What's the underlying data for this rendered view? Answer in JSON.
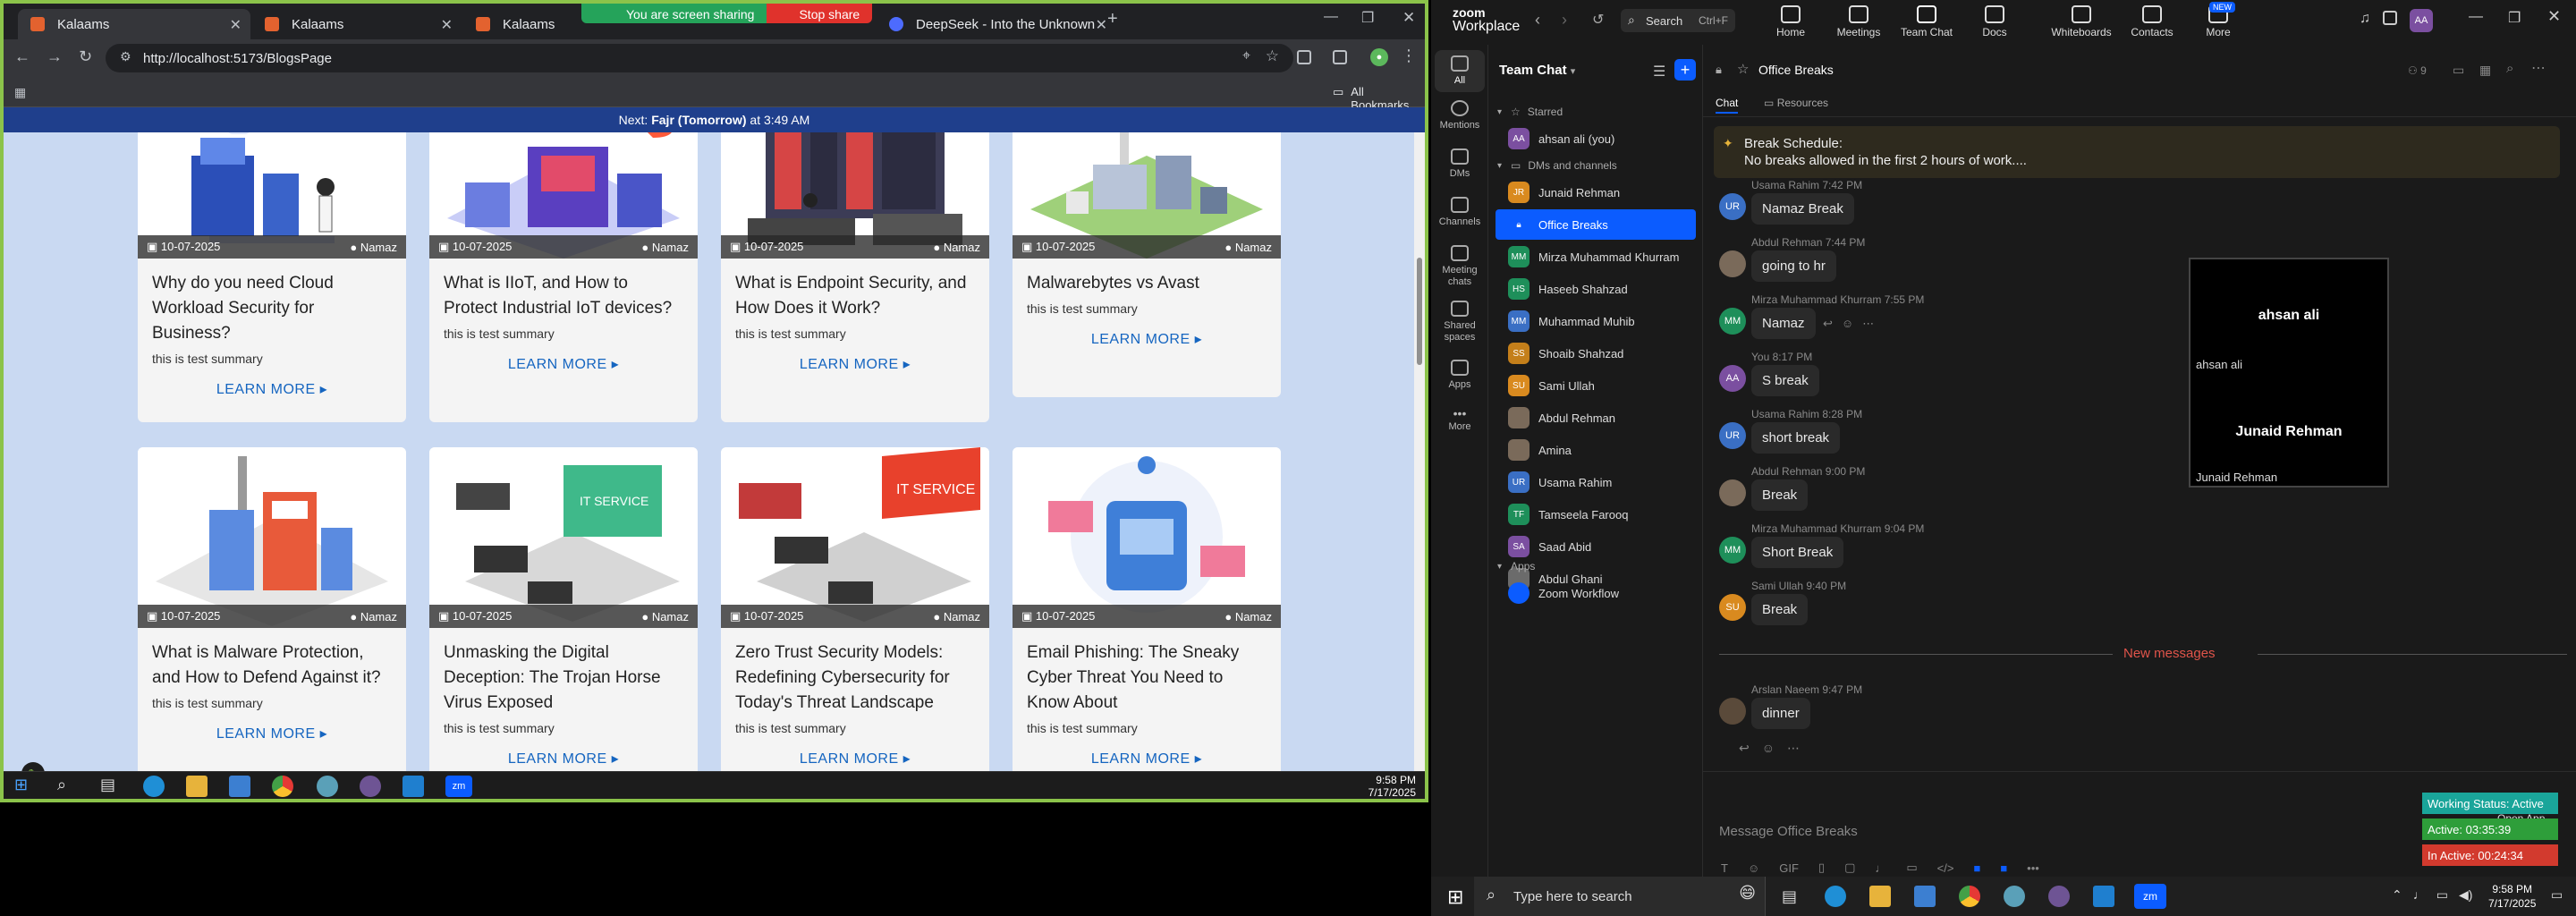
{
  "browser": {
    "tabs": [
      {
        "title": "Kalaams",
        "active": true
      },
      {
        "title": "Kalaams",
        "active": false
      },
      {
        "title": "Kalaams",
        "active": false
      },
      {
        "title": "DeepSeek - Into the Unknown",
        "active": false
      }
    ],
    "share_status": "You are screen sharing",
    "stop_share": "Stop share",
    "url": "http://localhost:5173/BlogsPage",
    "bookmarks_label": "All Bookmarks"
  },
  "page": {
    "prayer_prefix": "Next:",
    "prayer_name": "Fajr (Tomorrow)",
    "prayer_time": "at 3:49 AM",
    "learn_more": "LEARN MORE",
    "cards": [
      {
        "date": "10-07-2025",
        "author": "Namaz",
        "title": "Why do you need Cloud Workload Security for Business?",
        "summary": "this is test summary"
      },
      {
        "date": "10-07-2025",
        "author": "Namaz",
        "title": "What is IIoT, and How to Protect Industrial IoT devices?",
        "summary": "this is test summary"
      },
      {
        "date": "10-07-2025",
        "author": "Namaz",
        "title": "What is Endpoint Security, and How Does it Work?",
        "summary": "this is test summary"
      },
      {
        "date": "10-07-2025",
        "author": "Namaz",
        "title": "Malwarebytes vs Avast",
        "summary": "this is test summary"
      },
      {
        "date": "10-07-2025",
        "author": "Namaz",
        "title": "What is Malware Protection, and How to Defend Against it?",
        "summary": "this is test summary"
      },
      {
        "date": "10-07-2025",
        "author": "Namaz",
        "title": "Unmasking the Digital Deception: The Trojan Horse Virus Exposed",
        "summary": "this is test summary"
      },
      {
        "date": "10-07-2025",
        "author": "Namaz",
        "title": "Zero Trust Security Models: Redefining Cybersecurity for Today's Threat Landscape",
        "summary": "this is test summary"
      },
      {
        "date": "10-07-2025",
        "author": "Namaz",
        "title": "Email Phishing: The Sneaky Cyber Threat You Need to Know About",
        "summary": "this is test summary"
      }
    ],
    "image_badge": "IT SERVICE"
  },
  "left_taskbar": {
    "time": "9:58 PM",
    "date": "7/17/2025"
  },
  "zoom": {
    "brand_top": "zoom",
    "brand_bottom": "Workplace",
    "search_label": "Search",
    "search_shortcut": "Ctrl+F",
    "nav": [
      "Home",
      "Meetings",
      "Team Chat",
      "Docs",
      "Whiteboards",
      "Contacts",
      "More"
    ],
    "new_badge": "NEW",
    "user_initials": "AA",
    "rail": [
      "All",
      "Mentions",
      "DMs",
      "Channels",
      "Meeting chats",
      "Shared spaces",
      "Apps",
      "More"
    ],
    "list_title": "Team Chat",
    "sections": {
      "starred": "Starred",
      "dms": "DMs and channels",
      "apps": "Apps"
    },
    "starred": [
      {
        "name": "ahsan ali (you)",
        "initials": "AA",
        "color": "#7b4fa0"
      }
    ],
    "contacts": [
      {
        "name": "Junaid Rehman",
        "initials": "JR",
        "color": "#d98a1f"
      },
      {
        "name": "Office Breaks",
        "initials": "",
        "color": "#0b5cff"
      },
      {
        "name": "Mirza Muhammad Khurram",
        "initials": "MM",
        "color": "#1e8f5a"
      },
      {
        "name": "Haseeb Shahzad",
        "initials": "HS",
        "color": "#1e8f5a"
      },
      {
        "name": "Muhammad Muhib",
        "initials": "MM",
        "color": "#3a6fc4"
      },
      {
        "name": "Shoaib Shahzad",
        "initials": "SS",
        "color": "#c47f1a"
      },
      {
        "name": "Sami Ullah",
        "initials": "SU",
        "color": "#d98a1f"
      },
      {
        "name": "Abdul Rehman",
        "initials": "",
        "color": "#7a6a5a"
      },
      {
        "name": "Amina",
        "initials": "",
        "color": "#7a6a5a"
      },
      {
        "name": "Usama Rahim",
        "initials": "UR",
        "color": "#3a6fc4"
      },
      {
        "name": "Tamseela Farooq",
        "initials": "TF",
        "color": "#1e8f5a"
      },
      {
        "name": "Saad Abid",
        "initials": "SA",
        "color": "#7b4fa0"
      },
      {
        "name": "Abdul Ghani",
        "initials": "",
        "color": "#6b6b6b"
      }
    ],
    "apps": [
      {
        "name": "Zoom Workflow"
      }
    ],
    "channel": {
      "title": "Office Breaks",
      "member_count": "9",
      "tabs": [
        "Chat",
        "Resources"
      ],
      "banner_title": "Break Schedule:",
      "banner_text": "No breaks allowed in the first 2 hours of work....",
      "new_messages": "New messages",
      "compose_placeholder": "Message Office Breaks",
      "messages": [
        {
          "sender": "Usama Rahim",
          "time": "7:42 PM",
          "text": "Namaz Break",
          "initials": "UR",
          "color": "#3a6fc4"
        },
        {
          "sender": "Abdul Rehman",
          "time": "7:44 PM",
          "text": "going to hr",
          "initials": "",
          "color": "#7a6a5a"
        },
        {
          "sender": "Mirza Muhammad Khurram",
          "time": "7:55 PM",
          "text": "Namaz",
          "initials": "MM",
          "color": "#1e8f5a"
        },
        {
          "sender": "You",
          "time": "8:17 PM",
          "text": "S break",
          "initials": "AA",
          "color": "#7b4fa0"
        },
        {
          "sender": "Usama Rahim",
          "time": "8:28 PM",
          "text": "short break",
          "initials": "UR",
          "color": "#3a6fc4"
        },
        {
          "sender": "Abdul Rehman",
          "time": "9:00 PM",
          "text": "Break",
          "initials": "",
          "color": "#7a6a5a"
        },
        {
          "sender": "Mirza Muhammad Khurram",
          "time": "9:04 PM",
          "text": "Short Break",
          "initials": "MM",
          "color": "#1e8f5a"
        },
        {
          "sender": "Sami Ullah",
          "time": "9:40 PM",
          "text": "Break",
          "initials": "SU",
          "color": "#d98a1f"
        },
        {
          "sender": "Arslan Naeem",
          "time": "9:47 PM",
          "text": "dinner",
          "initials": "",
          "color": "#5a4a3a"
        }
      ]
    },
    "video": {
      "tile1_name": "ahsan ali",
      "tile1_label": "ahsan ali",
      "tile2_name": "Junaid Rehman",
      "tile2_label": "Junaid Rehman"
    },
    "status": {
      "open_app": "Open App",
      "working": "Working Status: Active",
      "active": "Active: 03:35:39",
      "inactive": "In Active: 00:24:34"
    },
    "gif_label": "GIF"
  },
  "win_taskbar": {
    "search_placeholder": "Type here to search",
    "time": "9:58 PM",
    "date": "7/17/2025"
  }
}
